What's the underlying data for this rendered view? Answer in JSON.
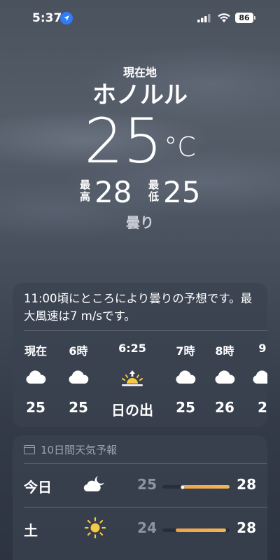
{
  "status_bar": {
    "time": "5:37",
    "battery": "86",
    "icons": [
      "location-arrow-icon",
      "cellular-signal-icon",
      "wifi-icon",
      "battery-icon"
    ]
  },
  "header": {
    "location_label": "現在地",
    "city": "ホノルル",
    "temperature": "25",
    "unit": "°C",
    "high_label": [
      "最",
      "高"
    ],
    "high": "28",
    "low_label": [
      "最",
      "低"
    ],
    "low": "25",
    "condition": "曇り"
  },
  "hourly_card": {
    "summary": "11:00頃にところにより曇りの予想です。最大風速は7 m/sです。",
    "hours": [
      {
        "label": "現在",
        "icon": "cloud-icon",
        "value": "25"
      },
      {
        "label": "6時",
        "icon": "cloud-icon",
        "value": "25"
      },
      {
        "label": "6:25",
        "icon": "sunrise-icon",
        "value": "日の出"
      },
      {
        "label": "7時",
        "icon": "cloud-icon",
        "value": "25"
      },
      {
        "label": "8時",
        "icon": "cloud-icon",
        "value": "26"
      },
      {
        "label": "9",
        "icon": "cloud-icon",
        "value": "2"
      }
    ]
  },
  "daily_card": {
    "title": "10日間天気予報",
    "days": [
      {
        "name": "今日",
        "icon": "partly-cloudy-night-icon",
        "low": "25",
        "high": "28",
        "range_start": 0.3,
        "range_end": 1.0,
        "current": 0.3
      },
      {
        "name": "土",
        "icon": "sun-icon",
        "low": "24",
        "high": "28",
        "range_start": 0.2,
        "range_end": 0.95
      }
    ]
  },
  "colors": {
    "accent_bar": "#f0a24a",
    "sun": "#f7c842",
    "location_arrow": "#2f7cf6"
  }
}
